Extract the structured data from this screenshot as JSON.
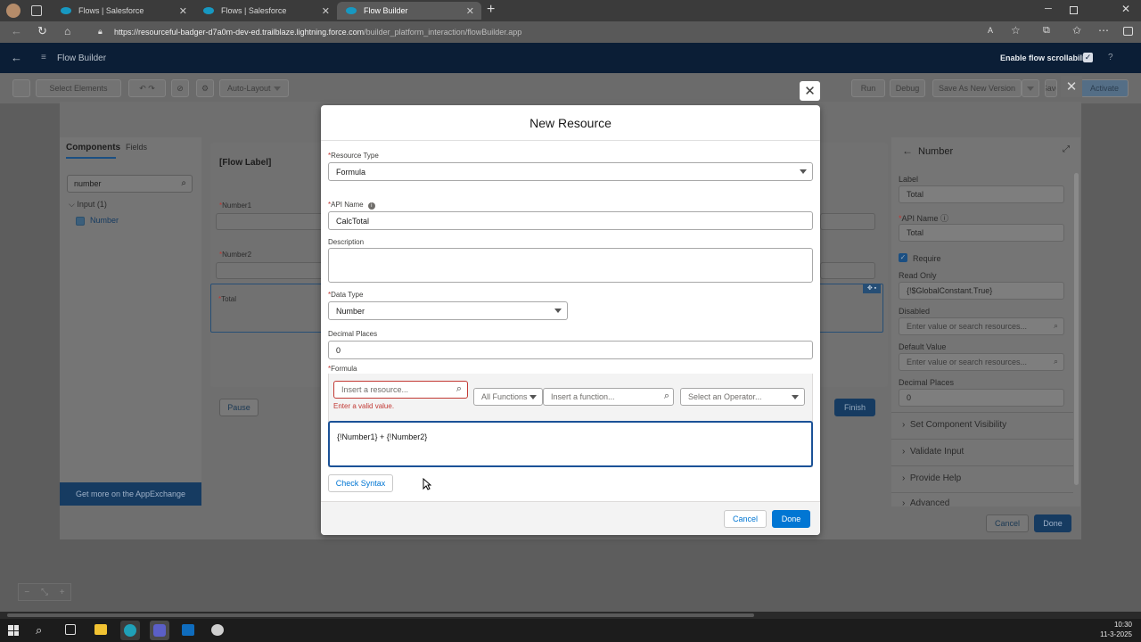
{
  "browser": {
    "tabs": [
      {
        "title": "Flows | Salesforce",
        "active": false
      },
      {
        "title": "Flows | Salesforce",
        "active": false
      },
      {
        "title": "Flow Builder",
        "active": true
      }
    ],
    "url_host": "https://resourceful-badger-d7a0m-dev-ed.trailblaze.lightning.force.com",
    "url_path": "/builder_platform_interaction/flowBuilder.app"
  },
  "header": {
    "app_title": "Flow Builder",
    "scroll_label": "Enable flow scrollability",
    "help": "?"
  },
  "toolbar": {
    "select_elements": "Select Elements",
    "auto_layout": "Auto-Layout",
    "right_buttons": [
      "Run",
      "Debug",
      "Save As New Version",
      "Save",
      "Activate"
    ]
  },
  "left_panel": {
    "tab_components": "Components",
    "tab_fields": "Fields",
    "search_value": "number",
    "group": "Input (1)",
    "item": "Number",
    "appexchange": "Get more on the AppExchange"
  },
  "canvas": {
    "flow_label": "[Flow Label]",
    "fields": [
      "Number1",
      "Number2",
      "Total"
    ],
    "pause": "Pause",
    "finish": "Finish"
  },
  "right_panel": {
    "title": "Number",
    "label_lbl": "Label",
    "label_val": "Total",
    "api_lbl": "API Name",
    "api_val": "Total",
    "require": "Require",
    "readonly_lbl": "Read Only",
    "readonly_val": "{!$GlobalConstant.True}",
    "disabled_lbl": "Disabled",
    "disabled_ph": "Enter value or search resources...",
    "default_lbl": "Default Value",
    "default_ph": "Enter value or search resources...",
    "decimal_lbl": "Decimal Places",
    "decimal_val": "0",
    "sections": [
      "Set Component Visibility",
      "Validate Input",
      "Provide Help",
      "Advanced"
    ],
    "cancel": "Cancel",
    "done": "Done"
  },
  "modal": {
    "title": "New Resource",
    "resource_type_label": "Resource Type",
    "resource_type_value": "Formula",
    "api_name_label": "API Name",
    "api_name_value": "CalcTotal",
    "description_label": "Description",
    "description_value": "",
    "data_type_label": "Data Type",
    "data_type_value": "Number",
    "decimal_places_label": "Decimal Places",
    "decimal_places_value": "0",
    "formula_label": "Formula",
    "resource_placeholder": "Insert a resource...",
    "error_text": "Enter a valid value.",
    "functions_filter": "All Functions",
    "function_placeholder": "Insert a function...",
    "operator_placeholder": "Select an Operator...",
    "formula_value": "{!Number1} + {!Number2}",
    "check_syntax": "Check Syntax",
    "cancel": "Cancel",
    "done": "Done"
  },
  "taskbar": {
    "time": "10:30",
    "date": "11-3-2025"
  }
}
